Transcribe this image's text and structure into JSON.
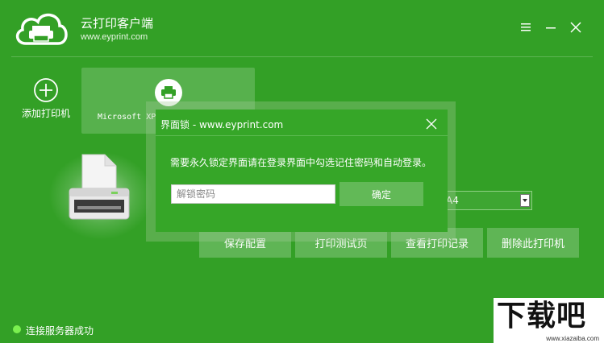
{
  "app": {
    "title": "云打印客户端",
    "url": "www.eyprint.com"
  },
  "sidebar": {
    "add_printer_label": "添加打印机"
  },
  "printer_card": {
    "name": "Microsoft XPS Document Writer"
  },
  "paper_select": {
    "value": "A4"
  },
  "actions": {
    "save": "保存配置",
    "test_page": "打印测试页",
    "view_records": "查看打印记录",
    "delete_printer": "删除此打印机"
  },
  "status": {
    "text": "连接服务器成功",
    "color": "#7bf04f"
  },
  "dialog": {
    "title": "界面锁 - www.eyprint.com",
    "message": "需要永久锁定界面请在登录界面中勾选记住密码和自动登录。",
    "input_placeholder": "解锁密码",
    "input_value": "",
    "ok_label": "确定"
  },
  "watermark": {
    "big": "下载吧",
    "small": "www.xiazaiba.com"
  },
  "colors": {
    "background": "#33a026",
    "dialog_bg": "#36a628"
  }
}
